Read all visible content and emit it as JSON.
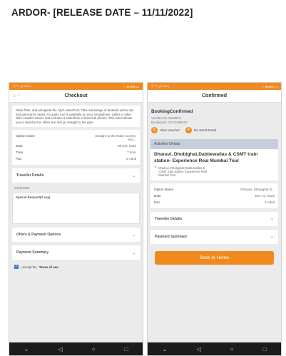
{
  "page_title": "ARDOR- [RELEASE DATE – 11/11/2022]",
  "colors": {
    "accent": "#f08a1f",
    "nav": "#1b1b1b",
    "section": "#c5cfdc"
  },
  "icons": {
    "back": "chevron-left-icon",
    "home": "home-icon",
    "expand": "chevron-down-icon",
    "navbar": [
      "back-triangle-icon",
      "home-circle-icon",
      "recents-square-icon"
    ]
  },
  "checkout": {
    "status_left": "Ⓐ ᵀᴬ ⊿ 3:59 ₒ",
    "status_right": "⌁ ⊞ 89% ▭",
    "title": "Checkout",
    "description": "State Park, and alongside the city's waterfront. Take advantage of fantastic photo ops and panoramic views. An audio tour is available on your smartphone, tablet or other WiFi-enabled device and includes a slideshow of historical photos. This ticket allows you to skip the box office line and go straight to the gate.",
    "details": [
      {
        "label": "Option Name",
        "value": "Straight to the State Access: San..."
      },
      {
        "label": "Date",
        "value": "09 Dec 2022"
      },
      {
        "label": "Time",
        "value": "7 hour"
      },
      {
        "label": "Pax",
        "value": "2 Adult"
      }
    ],
    "traveller_details": "Traveller Details",
    "comment_label": "Comment",
    "comment_placeholder": "Special Request(if any)",
    "offers": "Offers & Payment Options",
    "payment_summary": "Payment Summary",
    "terms_prefix": "I accept the",
    "terms_link": "Terms of use"
  },
  "confirmed": {
    "status_left": "Ⓐ ᵀᴬ ⊿ 3:55 ₒ",
    "status_right": "⌁ ⊞ 88% ▭",
    "title": "Confirmed",
    "booking_status": "BookingConfirmed",
    "voucher_id": "Voucher ID: 50200F3",
    "booking_id": "Booking ID: 22171965407",
    "view_voucher": "View Voucher",
    "resend_email": "Re-Send Email",
    "activities_header": "Activities Details",
    "tour_title": "Dharavi, Dhobighat,Dabbewallas & CSMT train station- Experience Real Mumbai Tour",
    "tour_place": "Dharavi, Dhobighat,Dabbewallas & CSMT train station- Experience Real Mumbai Tour",
    "details": [
      {
        "label": "Option Name",
        "value": "Dharavi, Dhobighat,D..."
      },
      {
        "label": "Date",
        "value": "Dec 21, 2022"
      },
      {
        "label": "Pax",
        "value": "2 Adult"
      }
    ],
    "traveller_details": "Traveller Details",
    "payment_summary": "Payment Summary",
    "back_home": "Back to Home"
  }
}
